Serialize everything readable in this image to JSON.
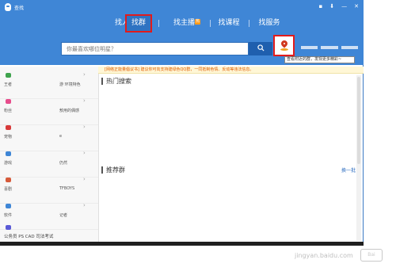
{
  "window": {
    "title": "查找",
    "controls": [
      "▪",
      "⬇",
      "—",
      "✕"
    ]
  },
  "nav": {
    "tabs": [
      {
        "label": "找人"
      },
      {
        "label": "找群"
      },
      {
        "label": "找主播",
        "badge": "热"
      },
      {
        "label": "找课程"
      },
      {
        "label": "找服务"
      }
    ]
  },
  "search": {
    "placeholder": "你最喜欢哪位明星？",
    "button_icon": "search-icon"
  },
  "location": {
    "tooltip": "查看附近的群，发现更多精彩~"
  },
  "notice": {
    "text": "[网络正能量倡议书] 建议你可向支持建绿色QQ群，一同抵制色情、反动等违法信息。"
  },
  "sidebar": {
    "categories": [
      {
        "label": "王者",
        "sub": "游 环境特色",
        "icon": "gamepad-icon",
        "color": "#3fa34d"
      },
      {
        "label": "粉丝",
        "sub": "敖用的偶感",
        "icon": "star-icon",
        "color": "#e74c8c"
      },
      {
        "label": "宠物",
        "sub": "e",
        "icon": "heart-icon",
        "color": "#d83a3a"
      },
      {
        "label": "游戏",
        "sub": "仍然",
        "icon": "controller-icon",
        "color": "#3f86d6"
      },
      {
        "label": "喜剧",
        "sub": "TFBOYS",
        "icon": "ticket-icon",
        "color": "#d65a3a"
      },
      {
        "label": "软件",
        "sub": "记者",
        "icon": "people-icon",
        "color": "#3f86d6"
      },
      {
        "label": "公务员 PS CAD 司法考试",
        "icon": "book-icon",
        "color": "#5a5ad6"
      }
    ]
  },
  "sections": {
    "hot_search": "热门搜索",
    "recommended": "推荐群",
    "refresh": "换一批"
  },
  "watermark": {
    "text": "jingyan.baidu.com",
    "badge": "Bai"
  }
}
